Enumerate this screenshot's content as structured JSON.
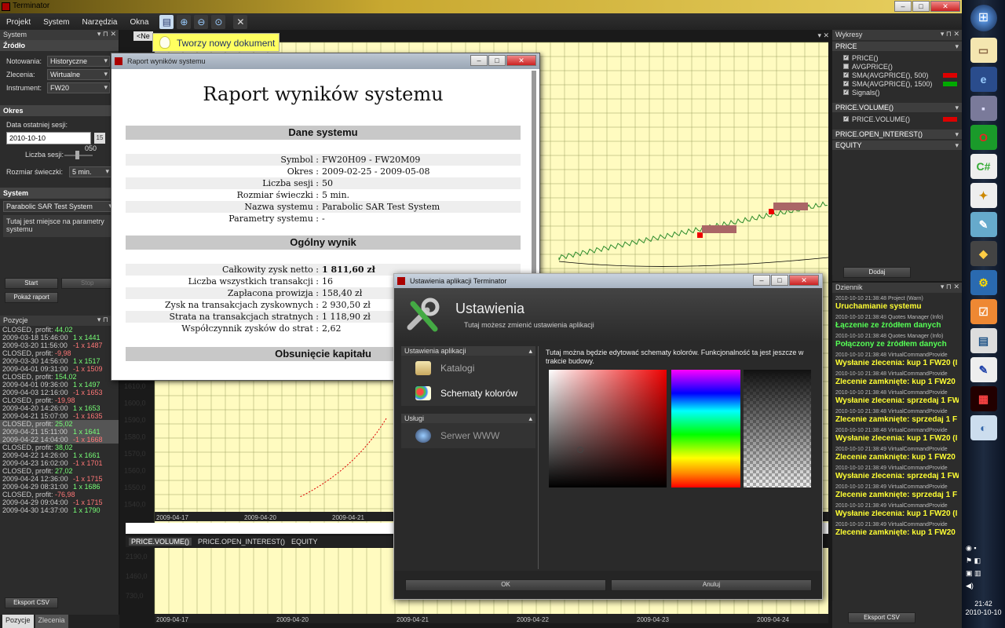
{
  "window": {
    "title": "Terminator"
  },
  "menu": {
    "items": [
      "Projekt",
      "System",
      "Narzędzia",
      "Okna"
    ]
  },
  "tooltip": {
    "text": "Tworzy nowy dokument"
  },
  "left": {
    "title": "System",
    "zrodlo": {
      "header": "Źródło",
      "notowania_label": "Notowania:",
      "notowania_value": "Historyczne",
      "zlecenia_label": "Zlecenia:",
      "zlecenia_value": "Wirtualne",
      "instrument_label": "Instrument:",
      "instrument_value": "FW20"
    },
    "okres": {
      "header": "Okres",
      "data_label": "Data ostatniej sesji:",
      "data_value": "2010-10-10",
      "cal_icon": "15",
      "liczba_label": "Liczba sesji:",
      "liczba_value": "050",
      "rozmiar_label": "Rozmiar świeczki:",
      "rozmiar_value": "5 min."
    },
    "system": {
      "header": "System",
      "value": "Parabolic SAR Test System",
      "params_text": "Tutaj jest miejsce na parametry systemu"
    },
    "buttons": {
      "start": "Start",
      "stop": "Stop",
      "report": "Pokaż raport"
    },
    "pozycje": {
      "title": "Pozycje",
      "export": "Eksport CSV",
      "tab1": "Pozycje",
      "tab2": "Zlecenia",
      "items": [
        {
          "h": "CLOSED, profit: ",
          "p": "44,02",
          "l1d": "2009-03-18 15:46:00",
          "l1q": "1 x 1441",
          "l2d": "2009-03-20 11:56:00",
          "l2q": "-1 x 1487",
          "pg": true
        },
        {
          "h": "CLOSED, profit: ",
          "p": "-9,98",
          "l1d": "2009-03-30 14:56:00",
          "l1q": "1 x 1517",
          "l2d": "2009-04-01 09:31:00",
          "l2q": "-1 x 1509",
          "pg": false
        },
        {
          "h": "CLOSED, profit: ",
          "p": "154,02",
          "l1d": "2009-04-01 09:36:00",
          "l1q": "1 x 1497",
          "l2d": "2009-04-03 12:16:00",
          "l2q": "-1 x 1653",
          "pg": true
        },
        {
          "h": "CLOSED, profit: ",
          "p": "-19,98",
          "l1d": "2009-04-20 14:26:00",
          "l1q": "1 x 1653",
          "l2d": "2009-04-21 15:07:00",
          "l2q": "-1 x 1635",
          "pg": false
        },
        {
          "h": "CLOSED, profit: ",
          "p": "25,02",
          "l1d": "2009-04-21 15:11:00",
          "l1q": "1 x 1641",
          "l2d": "2009-04-22 14:04:00",
          "l2q": "-1 x 1668",
          "pg": true
        },
        {
          "h": "CLOSED, profit: ",
          "p": "38,02",
          "l1d": "2009-04-22 14:26:00",
          "l1q": "1 x 1661",
          "l2d": "2009-04-23 16:02:00",
          "l2q": "-1 x 1701",
          "pg": true
        },
        {
          "h": "CLOSED, profit: ",
          "p": "27,02",
          "l1d": "2009-04-24 12:36:00",
          "l1q": "-1 x 1715",
          "l2d": "2009-04-29 08:31:00",
          "l2q": "1 x 1686",
          "pg": true
        },
        {
          "h": "CLOSED, profit: ",
          "p": "-76,98",
          "l1d": "2009-04-29 09:04:00",
          "l1q": "-1 x 1715",
          "l2d": "2009-04-30 14:37:00",
          "l2q": "1 x 1790",
          "pg": false
        }
      ]
    }
  },
  "chart": {
    "doc_tab": "<Ne",
    "y_ticks": [
      "1610,0",
      "1600,0",
      "1590,0",
      "1580,0",
      "1570,0",
      "1560,0",
      "1550,0",
      "1540,0"
    ],
    "date_labels": [
      "2009-04-17",
      "2009-04-20",
      "2009-04-21"
    ],
    "sub_tabs": [
      "PRICE.VOLUME()",
      "PRICE.OPEN_INTEREST()",
      "EQUITY"
    ],
    "vol_ticks": [
      "2190,0",
      "1460,0",
      "730,0"
    ],
    "bottom_dates": [
      "2009-04-17",
      "2009-04-20",
      "2009-04-21",
      "2009-04-22",
      "2009-04-23",
      "2009-04-24"
    ]
  },
  "report": {
    "window_title": "Raport wyników systemu",
    "heading": "Raport wyników systemu",
    "dane_header": "Dane systemu",
    "dane": [
      [
        "Symbol :",
        "FW20H09 - FW20M09"
      ],
      [
        "Okres :",
        "2009-02-25 - 2009-05-08"
      ],
      [
        "Liczba sesji :",
        "50"
      ],
      [
        "Rozmiar świeczki :",
        "5  min."
      ],
      [
        "Nazwa systemu :",
        "Parabolic SAR Test System"
      ],
      [
        "Parametry systemu :",
        "-"
      ]
    ],
    "wynik_header": "Ogólny wynik",
    "wynik": [
      [
        "Całkowity zysk netto :",
        "1 811,60 zł"
      ],
      [
        "Liczba wszystkich transakcji :",
        "16"
      ],
      [
        "Zapłacona prowizja :",
        "158,40 zł"
      ],
      [
        "Zysk na transakcjach zyskownych :",
        "2 930,50 zł"
      ],
      [
        "Strata na transakcjach stratnych :",
        "1 118,90 zł"
      ],
      [
        "Współczynnik zysków do strat :",
        "2,62"
      ]
    ],
    "obsuniecie_header": "Obsunięcie kapitału"
  },
  "settings": {
    "window_title": "Ustawienia aplikacji Terminator",
    "title": "Ustawienia",
    "subtitle": "Tutaj możesz zmienić ustawienia aplikacji",
    "group1": "Ustawienia aplikacji",
    "item_katalogi": "Katalogi",
    "item_schematy": "Schematy kolorów",
    "group2": "Usługi",
    "item_www": "Serwer WWW",
    "description": "Tutaj można będzie edytować schematy kolorów. Funkcjonalność ta jest jeszcze w trakcie budowy.",
    "ok": "OK",
    "cancel": "Anuluj"
  },
  "wykresy": {
    "title": "Wykresy",
    "price_header": "PRICE",
    "series": [
      {
        "name": "PRICE()",
        "checked": true,
        "color": ""
      },
      {
        "name": "AVGPRICE()",
        "checked": false,
        "color": ""
      },
      {
        "name": "SMA(AVGPRICE(), 500)",
        "checked": true,
        "color": "#dd0000"
      },
      {
        "name": "SMA(AVGPRICE(), 1500)",
        "checked": true,
        "color": "#00aa00"
      },
      {
        "name": "Signals()",
        "checked": true,
        "color": ""
      }
    ],
    "vol_header": "PRICE.VOLUME()",
    "vol_item": "PRICE.VOLUME()",
    "oi_header": "PRICE.OPEN_INTEREST()",
    "eq_header": "EQUITY",
    "add": "Dodaj"
  },
  "dziennik": {
    "title": "Dziennik",
    "export": "Eksport CSV",
    "entries": [
      {
        "t": "2010-10-10 21:38:48 Project (Warn)",
        "m": "Uruchamianie systemu",
        "c": "y"
      },
      {
        "t": "2010-10-10 21:38:48 Quotes Manager (Info)",
        "m": "Łączenie ze źródłem danych",
        "c": "g"
      },
      {
        "t": "2010-10-10 21:38:48 Quotes Manager (Info)",
        "m": "Połączony ze źródłem danych",
        "c": "g"
      },
      {
        "t": "2010-10-10 21:38:48 VirtualCommandProvide",
        "m": "Wysłanie zlecenia: kup 1 FW20 (l",
        "c": "y"
      },
      {
        "t": "2010-10-10 21:38:48 VirtualCommandProvide",
        "m": "Zlecenie zamknięte: kup 1 FW20",
        "c": "y"
      },
      {
        "t": "2010-10-10 21:38:48 VirtualCommandProvide",
        "m": "Wysłanie zlecenia: sprzedaj 1 FW",
        "c": "y"
      },
      {
        "t": "2010-10-10 21:38:48 VirtualCommandProvide",
        "m": "Zlecenie zamknięte: sprzedaj 1 F",
        "c": "y"
      },
      {
        "t": "2010-10-10 21:38:48 VirtualCommandProvide",
        "m": "Wysłanie zlecenia: kup 1 FW20 (l",
        "c": "y"
      },
      {
        "t": "2010-10-10 21:38:49 VirtualCommandProvide",
        "m": "Zlecenie zamknięte: kup 1 FW20",
        "c": "y"
      },
      {
        "t": "2010-10-10 21:38:49 VirtualCommandProvide",
        "m": "Wysłanie zlecenia: sprzedaj 1 FW",
        "c": "y"
      },
      {
        "t": "2010-10-10 21:38:49 VirtualCommandProvide",
        "m": "Zlecenie zamknięte: sprzedaj 1 F",
        "c": "y"
      },
      {
        "t": "2010-10-10 21:38:49 VirtualCommandProvide",
        "m": "Wysłanie zlecenia: kup 1 FW20 (l",
        "c": "y"
      },
      {
        "t": "2010-10-10 21:38:49 VirtualCommandProvide",
        "m": "Zlecenie zamknięte: kup 1 FW20",
        "c": "y"
      }
    ]
  },
  "taskbar": {
    "time": "21:42",
    "date": "2010-10-10"
  }
}
